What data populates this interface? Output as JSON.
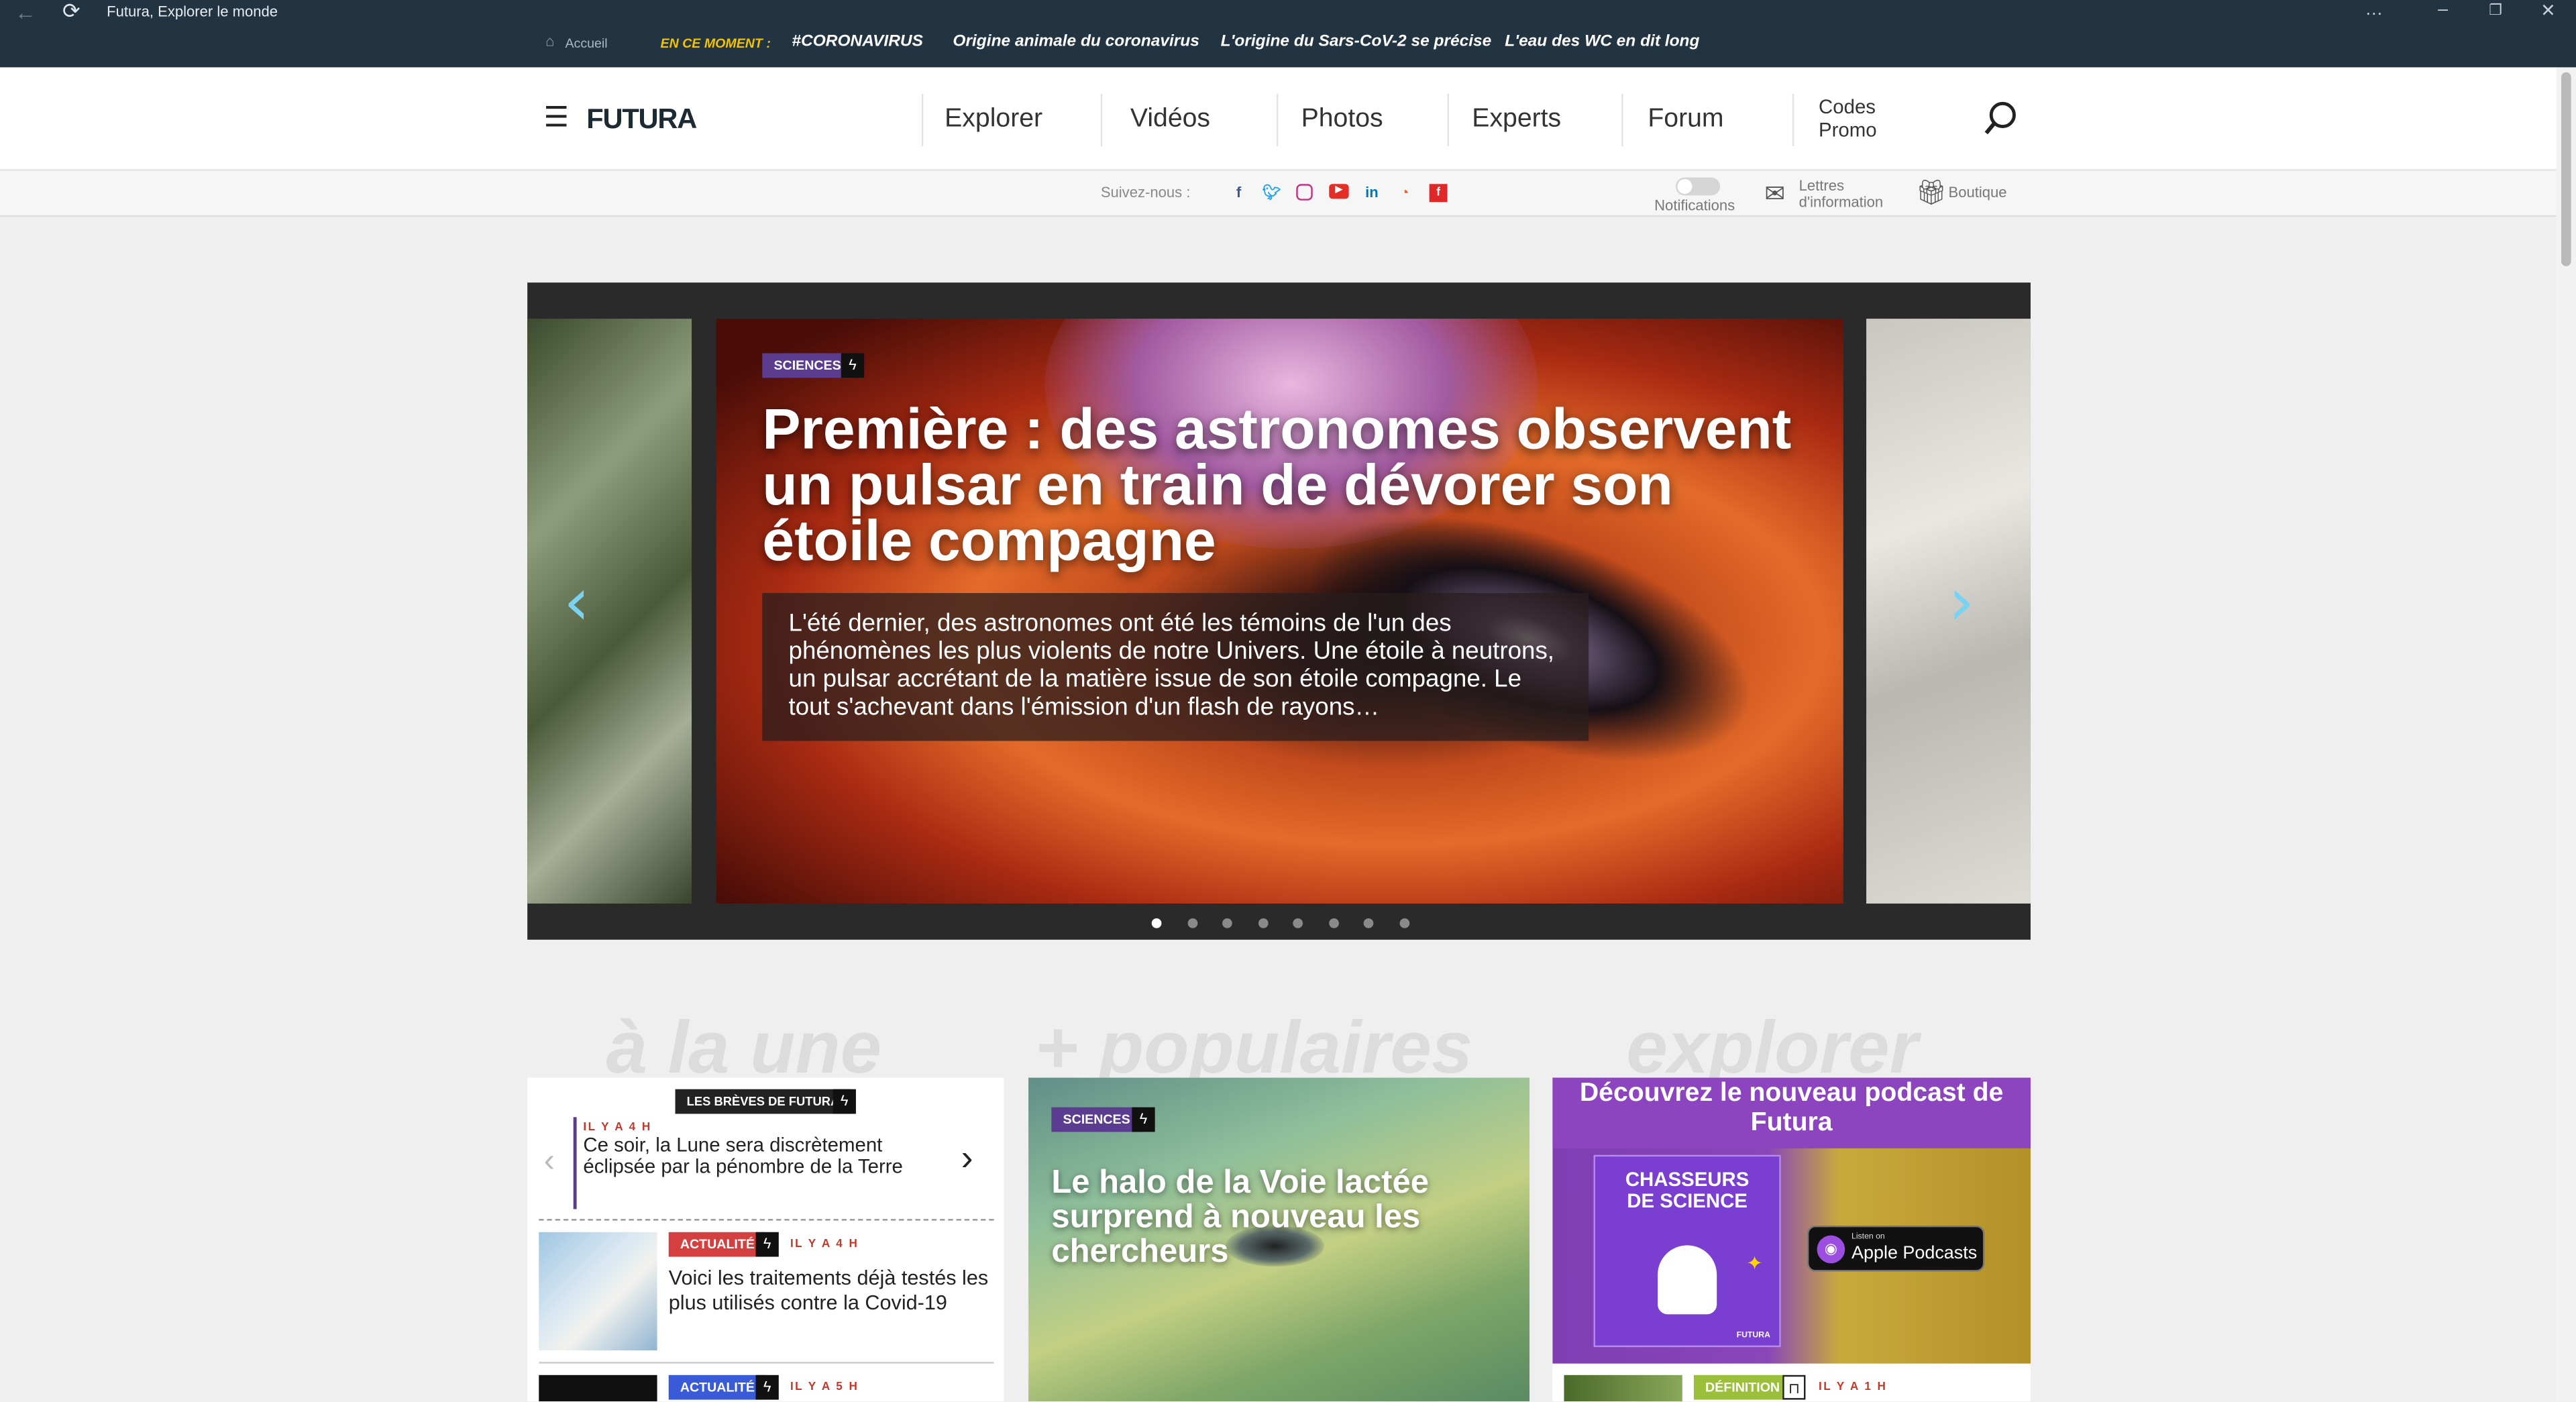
{
  "window": {
    "title": "Futura, Explorer le monde",
    "controls": [
      "…",
      "–",
      "❐",
      "✕"
    ]
  },
  "topbar": {
    "home_label": "Accueil",
    "moment_label": "EN CE MOMENT :",
    "hot_links": [
      "#CORONAVIRUS",
      "Origine animale du coronavirus",
      "L'origine du Sars-CoV-2 se précise",
      "L'eau des WC en dit long"
    ]
  },
  "header": {
    "logo": "FUTURA",
    "nav": [
      "Explorer",
      "Vidéos",
      "Photos",
      "Experts",
      "Forum"
    ],
    "promo_line1": "Codes",
    "promo_line2": "Promo"
  },
  "follow": {
    "label": "Suivez-nous :",
    "notifications": "Notifications",
    "letters_line1": "Lettres",
    "letters_line2": "d'information",
    "shop": "Boutique"
  },
  "hero": {
    "tag": "SCIENCES",
    "title": "Première : des astronomes observent un pulsar en train de dévorer son étoile compagne",
    "description": "L'été dernier, des astronomes ont été les témoins de l'un des phénomènes les plus violents de notre Univers. Une étoile à neutrons, un pulsar accrétant de la matière issue de son étoile compagne. Le tout s'achevant dans l'émission d'un flash de rayons…",
    "slide_count": 8,
    "active_slide": 1
  },
  "sections": {
    "une": "à la une",
    "populaires": "+ populaires",
    "explorer": "explorer"
  },
  "col1": {
    "breves_label": "LES BRÈVES DE FUTURA",
    "breve_time": "IL Y A 4 H",
    "breve_text": "Ce soir, la Lune sera discrètement éclipsée par la pénombre de la Terre",
    "item1": {
      "tag": "ACTUALITÉ",
      "time": "IL Y A 4 H",
      "text": "Voici les traitements déjà testés les plus utilisés contre la Covid-19"
    },
    "item2": {
      "tag": "ACTUALITÉ",
      "time": "IL Y A 5 H"
    }
  },
  "col2": {
    "tag": "SCIENCES",
    "title": "Le halo de la Voie lactée surprend à nouveau les chercheurs"
  },
  "col3": {
    "banner_title": "Découvrez le nouveau podcast de Futura",
    "cover_line1": "CHASSEURS",
    "cover_line2": "DE SCIENCE",
    "cover_brand": "FUTURA",
    "apple_small": "Listen on",
    "apple_big": "Apple Podcasts",
    "item": {
      "tag": "DÉFINITION",
      "time": "IL Y A 1 H"
    }
  }
}
